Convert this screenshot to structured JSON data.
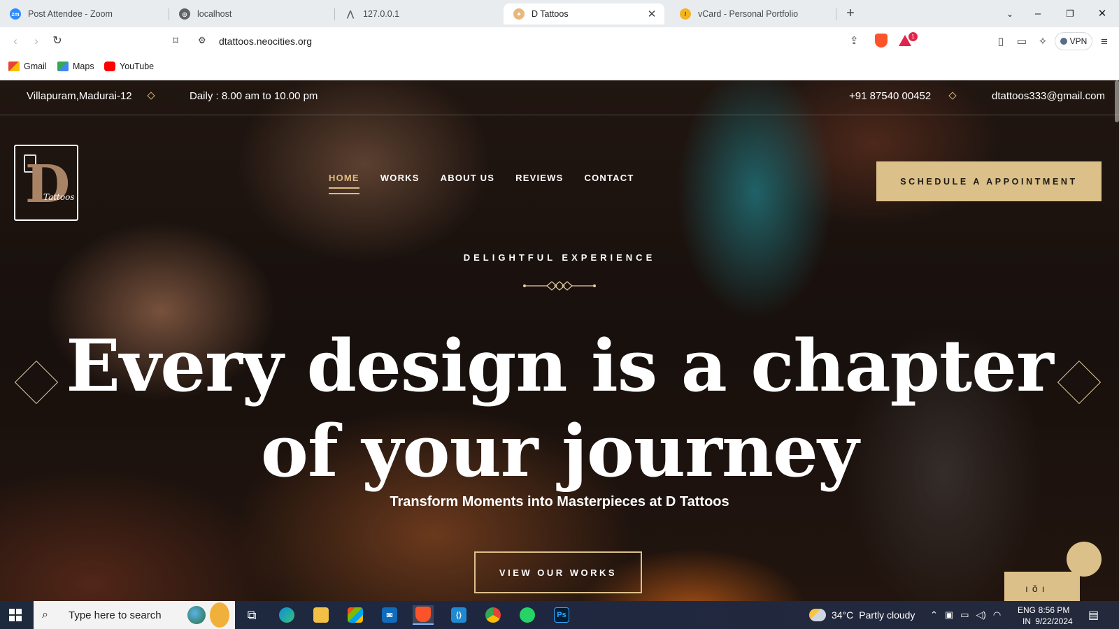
{
  "browser": {
    "tabs": [
      {
        "title": "Post Attendee - Zoom",
        "icon": "zoom-icon",
        "active": false
      },
      {
        "title": "localhost",
        "icon": "globe-icon",
        "active": false
      },
      {
        "title": "127.0.0.1",
        "icon": "site-icon",
        "active": false
      },
      {
        "title": "D Tattoos",
        "icon": "tattoo-icon",
        "active": true
      },
      {
        "title": "vCard - Personal Portfolio",
        "icon": "vcard-icon",
        "active": false
      }
    ],
    "url": "dtattoos.neocities.org",
    "vpn_label": "VPN",
    "notification_count": "1",
    "bookmarks": [
      {
        "label": "Gmail",
        "icon": "gmail-icon"
      },
      {
        "label": "Maps",
        "icon": "maps-icon"
      },
      {
        "label": "YouTube",
        "icon": "youtube-icon"
      }
    ]
  },
  "site": {
    "topbar": {
      "address": "Villapuram,Madurai-12",
      "hours": "Daily : 8.00 am to 10.00 pm",
      "phone": "+91 87540 00452",
      "email": "dtattoos333@gmail.com"
    },
    "logo": {
      "letter": "D",
      "script": "Tattoos"
    },
    "nav": [
      {
        "label": "HOME",
        "active": true
      },
      {
        "label": "WORKS",
        "active": false
      },
      {
        "label": "ABOUT US",
        "active": false
      },
      {
        "label": "REVIEWS",
        "active": false
      },
      {
        "label": "CONTACT",
        "active": false
      }
    ],
    "cta_label": "SCHEDULE A APPOINTMENT",
    "hero": {
      "tagline": "DELIGHTFUL EXPERIENCE",
      "headline_line1": "Every design is a chapter",
      "headline_line2": "of your journey",
      "subheading": "Transform Moments into Masterpieces at D Tattoos",
      "button_label": "VIEW OUR WORKS"
    },
    "colors": {
      "accent": "#dcc08a",
      "text": "#ffffff"
    }
  },
  "taskbar": {
    "search_placeholder": "Type here to search",
    "weather": {
      "temp": "34°C",
      "condition": "Partly cloudy"
    },
    "language": {
      "line1": "ENG",
      "line2": "IN"
    },
    "time": "8:56 PM",
    "date": "9/22/2024"
  }
}
